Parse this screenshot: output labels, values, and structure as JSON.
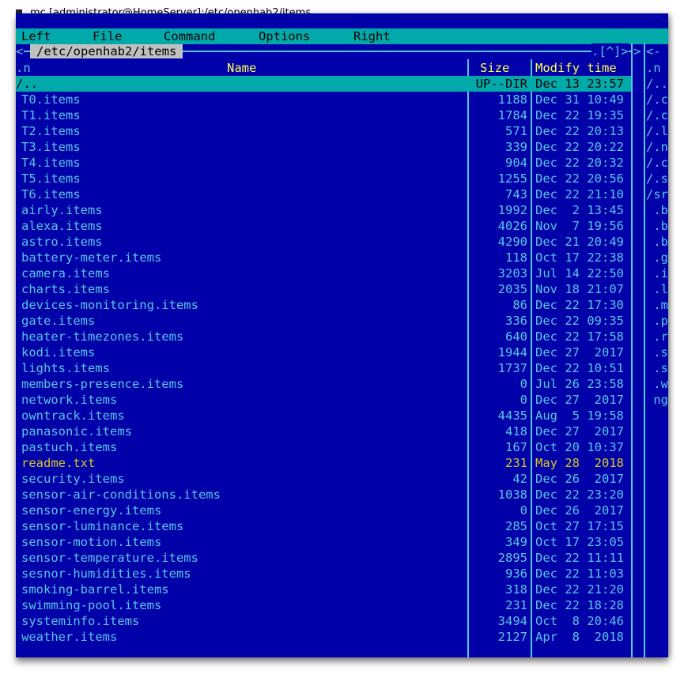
{
  "window": {
    "title": "mc [administrator@HomeServer]:/etc/openhab2/items"
  },
  "menubar": [
    "Left",
    "File",
    "Command",
    "Options",
    "Right"
  ],
  "left_panel": {
    "path": "/etc/openhab2/items",
    "top_right_indicator": ".[^]>",
    "columns": {
      "sort": ".n",
      "name": "Name",
      "size": "Size",
      "modify": "Modify time"
    },
    "rows": [
      {
        "name": "/..",
        "size": "UP--DIR",
        "date": "Dec 13 23:57"
      },
      {
        "name": "T0.items",
        "size": "1188",
        "date": "Dec 31 10:49"
      },
      {
        "name": "T1.items",
        "size": "1784",
        "date": "Dec 22 19:35"
      },
      {
        "name": "T2.items",
        "size": "571",
        "date": "Dec 22 20:13"
      },
      {
        "name": "T3.items",
        "size": "339",
        "date": "Dec 22 20:22"
      },
      {
        "name": "T4.items",
        "size": "904",
        "date": "Dec 22 20:32"
      },
      {
        "name": "T5.items",
        "size": "1255",
        "date": "Dec 22 20:56"
      },
      {
        "name": "T6.items",
        "size": "743",
        "date": "Dec 22 21:10"
      },
      {
        "name": "airly.items",
        "size": "1992",
        "date": "Dec  2 13:45"
      },
      {
        "name": "alexa.items",
        "size": "4026",
        "date": "Nov  7 19:56"
      },
      {
        "name": "astro.items",
        "size": "4290",
        "date": "Dec 21 20:49"
      },
      {
        "name": "battery-meter.items",
        "size": "118",
        "date": "Oct 17 22:38"
      },
      {
        "name": "camera.items",
        "size": "3203",
        "date": "Jul 14 22:50"
      },
      {
        "name": "charts.items",
        "size": "2035",
        "date": "Nov 18 21:07"
      },
      {
        "name": "devices-monitoring.items",
        "size": "86",
        "date": "Dec 22 17:30"
      },
      {
        "name": "gate.items",
        "size": "336",
        "date": "Dec 22 09:35"
      },
      {
        "name": "heater-timezones.items",
        "size": "640",
        "date": "Dec 22 17:58"
      },
      {
        "name": "kodi.items",
        "size": "1944",
        "date": "Dec 27  2017"
      },
      {
        "name": "lights.items",
        "size": "1737",
        "date": "Dec 22 10:51"
      },
      {
        "name": "members-presence.items",
        "size": "0",
        "date": "Jul 26 23:58"
      },
      {
        "name": "network.items",
        "size": "0",
        "date": "Dec 27  2017"
      },
      {
        "name": "owntrack.items",
        "size": "4435",
        "date": "Aug  5 19:58"
      },
      {
        "name": "panasonic.items",
        "size": "418",
        "date": "Dec 27  2017"
      },
      {
        "name": "pastuch.items",
        "size": "167",
        "date": "Oct 20 10:37"
      },
      {
        "name": "readme.txt",
        "size": "231",
        "date": "May 28  2018"
      },
      {
        "name": "security.items",
        "size": "42",
        "date": "Dec 26  2017"
      },
      {
        "name": "sensor-air-conditions.items",
        "size": "1038",
        "date": "Dec 22 23:20"
      },
      {
        "name": "sensor-energy.items",
        "size": "0",
        "date": "Dec 26  2017"
      },
      {
        "name": "sensor-luminance.items",
        "size": "285",
        "date": "Oct 27 17:15"
      },
      {
        "name": "sensor-motion.items",
        "size": "349",
        "date": "Oct 17 23:05"
      },
      {
        "name": "sensor-temperature.items",
        "size": "2895",
        "date": "Dec 22 11:11"
      },
      {
        "name": "sesnor-humidities.items",
        "size": "936",
        "date": "Dec 22 11:03"
      },
      {
        "name": "smoking-barrel.items",
        "size": "318",
        "date": "Dec 22 21:20"
      },
      {
        "name": "swimming-pool.items",
        "size": "231",
        "date": "Dec 22 18:28"
      },
      {
        "name": "systeminfo.items",
        "size": "3494",
        "date": "Oct  8 20:46"
      },
      {
        "name": "weather.items",
        "size": "2127",
        "date": "Apr  8  2018"
      }
    ]
  },
  "right_panel": {
    "corner": "<-",
    "sort": ".n",
    "items": [
      "/..",
      "/.c",
      "/.c",
      "/.l",
      "/.n",
      "/.c",
      "/.s",
      "/sr",
      " .b",
      " .b",
      " .b",
      " .g",
      " .i",
      " .l",
      " .m",
      " .p",
      " .r",
      " .s",
      " .s",
      " .w",
      " ng"
    ]
  },
  "colors": {
    "panel_bg": "#0000a8",
    "menubar_bg": "#00aaaa",
    "text_cyan": "#55c8e8",
    "header_yellow": "#ffff55",
    "selected_bg": "#00aaaa",
    "readme_yellow": "#d8c830"
  }
}
